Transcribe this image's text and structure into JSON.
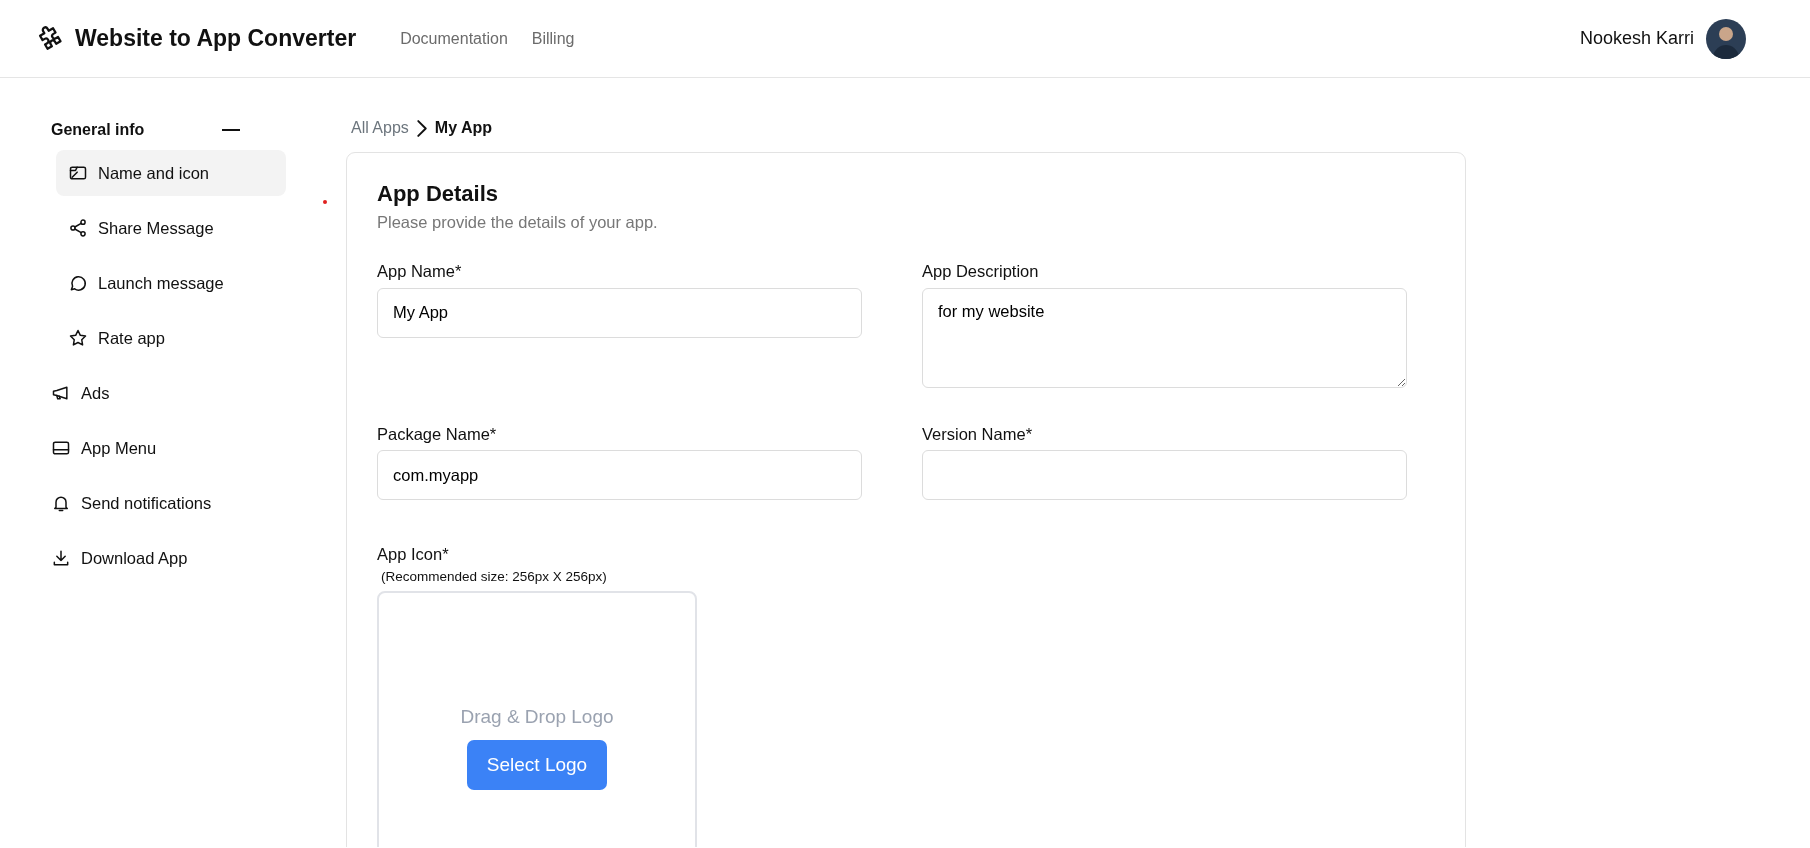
{
  "header": {
    "brand": "Website to App Converter",
    "nav": [
      {
        "label": "Documentation"
      },
      {
        "label": "Billing"
      }
    ],
    "user": {
      "name": "Nookesh Karri"
    }
  },
  "sidebar": {
    "group": {
      "title": "General info",
      "expanded": true,
      "items": [
        {
          "label": "Name and icon",
          "selected": true
        },
        {
          "label": "Share Message",
          "selected": false
        },
        {
          "label": "Launch message",
          "selected": false
        },
        {
          "label": "Rate app",
          "selected": false
        }
      ]
    },
    "items": [
      {
        "label": "Ads",
        "selected": false
      },
      {
        "label": "App Menu",
        "selected": false
      },
      {
        "label": "Send notifications",
        "selected": false
      },
      {
        "label": "Download App",
        "selected": false
      }
    ]
  },
  "breadcrumb": [
    "All Apps",
    "My App"
  ],
  "form": {
    "title": "App Details",
    "subtitle": "Please provide the details of your app.",
    "fields": [
      {
        "label": "App Name*",
        "kind": "input",
        "value": "My App"
      },
      {
        "label": "App Description",
        "kind": "textarea",
        "value": "for my website"
      },
      {
        "label": "Package Name*",
        "kind": "input",
        "value": "com.myapp"
      },
      {
        "label": "Version Name*",
        "kind": "input"
      }
    ],
    "app_icon": {
      "label": "App Icon*",
      "hint": "(Recommended size: 256px X 256px)",
      "drop_text": "Drag & Drop Logo",
      "button": "Select Logo"
    }
  }
}
